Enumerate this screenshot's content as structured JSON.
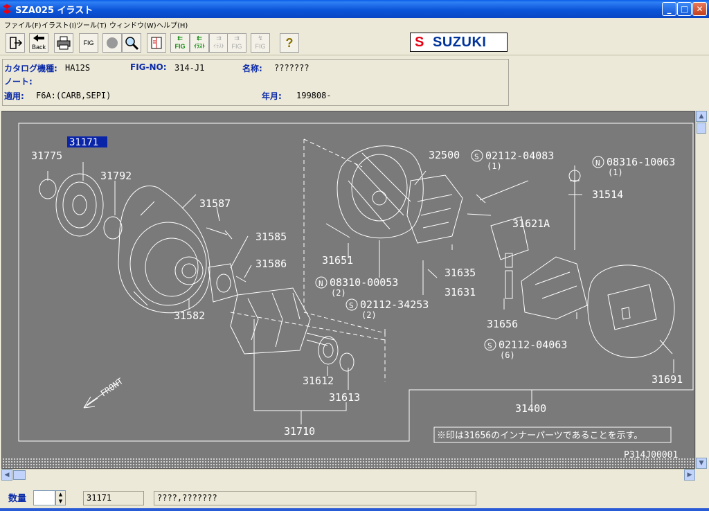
{
  "window": {
    "title": "SZA025 イラスト",
    "controls": {
      "minimize": "_",
      "maximize": "□",
      "close": "✕"
    }
  },
  "menu": [
    "ファイル(F)",
    "イラスト(I)",
    "ツール(T)",
    "ウィンドウ(W)",
    "ヘルプ(H)"
  ],
  "toolbar": {
    "back_label": "Back",
    "fig_label": "FIG",
    "fig_prev_label": "FIG",
    "illust_prev_label": "ｲﾗｽﾄ",
    "illust_next_label": "ｲﾗｽﾄ",
    "fig_next_label": "FIG",
    "fig_jump_label": "FIG",
    "help_label": "?",
    "brand": "SUZUKI"
  },
  "info": {
    "catalog_label": "カタログ機種:",
    "catalog_value": "HA12S",
    "fig_label": "FIG-NO:",
    "fig_value": "314-J1",
    "name_label": "名称:",
    "name_value": "???????",
    "note_label": "ノート:",
    "note_value": "",
    "apply_label": "適用:",
    "apply_value": "F6A:(CARB,SEPI)",
    "date_label": "年月:",
    "date_value": "199808-"
  },
  "diagram": {
    "selected_part": "31171",
    "parts": {
      "p31775": "31775",
      "p31792": "31792",
      "p31587": "31587",
      "p31585": "31585",
      "p31586": "31586",
      "p31582": "31582",
      "p32500": "32500",
      "p31651": "31651",
      "p31635": "31635",
      "p31631": "31631",
      "p31656": "31656",
      "p31621A": "31621A",
      "p31514": "31514",
      "p31612": "31612",
      "p31613": "31613",
      "p31710": "31710",
      "p31400": "31400",
      "p31691": "31691"
    },
    "bolts": {
      "b1": "02112-04083",
      "b1q": "(1)",
      "b2": "08316-10063",
      "b2q": "(1)",
      "b3": "08310-00053",
      "b3q": "(2)",
      "b4": "02112-34253",
      "b4q": "(2)",
      "b5": "02112-04063",
      "b5q": "(6)"
    },
    "front_label": "FRONT",
    "note": "※印は31656のインナーパーツであることを示す。",
    "ref_code": "P314J00001"
  },
  "status": {
    "qty_label": "数量",
    "qty_value": "",
    "part_no": "31171",
    "part_name": "????,???????"
  }
}
